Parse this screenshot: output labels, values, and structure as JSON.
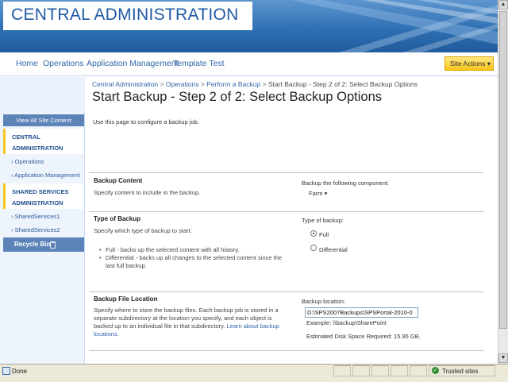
{
  "banner": {
    "title": "CENTRAL ADMINISTRATION"
  },
  "topnav": {
    "items": [
      "Home",
      "Operations",
      "Application Management",
      "Template Test"
    ],
    "site_actions": "Site Actions"
  },
  "breadcrumb": {
    "items": [
      "Central Administration",
      "Operations",
      "Perform a Backup"
    ],
    "current": "Start Backup - Step 2 of 2: Select Backup Options",
    "separator": ">"
  },
  "page_title": "Start Backup - Step 2 of 2: Select Backup Options",
  "leftnav": {
    "view_all": "View All Site Content",
    "groups": [
      {
        "heading": "CENTRAL ADMINISTRATION",
        "items": [
          "Operations",
          "Application Management"
        ]
      },
      {
        "heading": "SHARED SERVICES ADMINISTRATION",
        "items": [
          "SharedServices1",
          "SharedServices2"
        ]
      }
    ],
    "recycle_bin": "Recycle Bin"
  },
  "intro": "Use this page to configure a backup job.",
  "sections": {
    "content": {
      "title": "Backup Content",
      "description": "Specify content to include in the backup.",
      "control_label": "Backup the following component:",
      "selected": "Farm"
    },
    "type": {
      "title": "Type of Backup",
      "description": "Specify which type of backup to start:",
      "bullets": [
        "Full - backs up the selected content with all history.",
        "Differential - backs up all changes to the selected content since the last full backup."
      ],
      "control_label": "Type of backup:",
      "options": [
        "Full",
        "Differential"
      ],
      "selected": "Full"
    },
    "location": {
      "title": "Backup File Location",
      "description": "Specify where to store the backup files. Each backup job is stored in a separate subdirectory at the location you specify, and each object is backed up to an individual file in that subdirectory.",
      "link": "Learn about backup locations.",
      "control_label": "Backup location:",
      "value": "D:\\SPS2007Backups\\SPSPortal-2010-0",
      "example": "Example: \\\\backup\\SharePoint",
      "disk_space": "Estimated Disk Space Required: 15.95 GB."
    }
  },
  "statusbar": {
    "status": "Done",
    "zone": "Trusted sites"
  },
  "colors": {
    "banner": "#2f6fb3",
    "accent": "#f7c51b",
    "link": "#3366a8",
    "nav_header": "#5d84b8"
  }
}
